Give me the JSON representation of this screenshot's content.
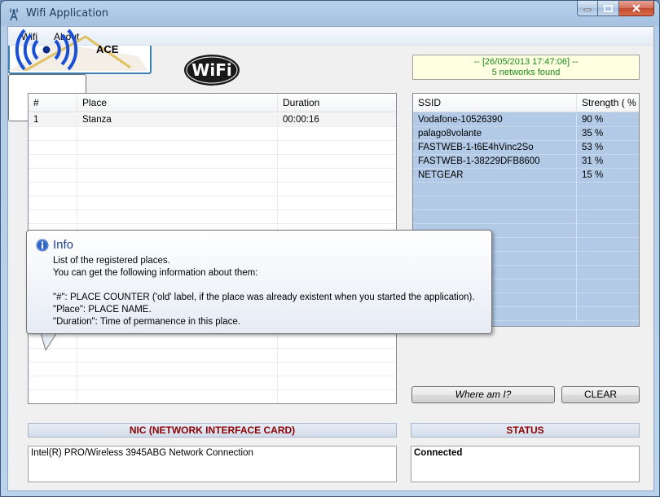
{
  "window": {
    "title": "Wifi Application"
  },
  "menu": {
    "items": [
      "Wifi",
      "About"
    ]
  },
  "logo": {
    "text": "WiFi"
  },
  "scan": {
    "timestamp": "-- [26/05/2013 17:47:06] --",
    "count": "5 networks found"
  },
  "places": {
    "columns": [
      "#",
      "Place",
      "Duration"
    ],
    "rows": [
      {
        "num": "1",
        "place": "Stanza",
        "duration": "00:00:16"
      }
    ]
  },
  "networks": {
    "columns": [
      "SSID",
      "Strength ( % )"
    ],
    "rows": [
      {
        "ssid": "Vodafone-10526390",
        "strength": "90 %"
      },
      {
        "ssid": "palago8volante",
        "strength": "35 %"
      },
      {
        "ssid": "FASTWEB-1-t6E4hVinc2So",
        "strength": "53 %"
      },
      {
        "ssid": "FASTWEB-1-38229DFB8600",
        "strength": "31 %"
      },
      {
        "ssid": "NETGEAR",
        "strength": "15 %"
      }
    ]
  },
  "buttons": {
    "place_label": "ACE",
    "where_label": "Where am I?",
    "clear_label": "CLEAR"
  },
  "nic": {
    "header": "NIC (NETWORK INTERFACE CARD)",
    "value": "Intel(R) PRO/Wireless 3945ABG Network Connection"
  },
  "status": {
    "header": "STATUS",
    "value": "Connected"
  },
  "tooltip": {
    "title": "Info",
    "lines": [
      "List of the registered places.",
      "You can get the following information about them:",
      "\"#\": PLACE COUNTER ('old' label, if the place was already existent when you started the application).",
      "\"Place\": PLACE NAME.",
      "\"Duration\": Time of permanence in this place."
    ]
  },
  "colors": {
    "status_header": "#8b0000",
    "date_text": "#1a8a1a",
    "network_row": "#b2cae6",
    "tooltip_title": "#1c3f94"
  }
}
